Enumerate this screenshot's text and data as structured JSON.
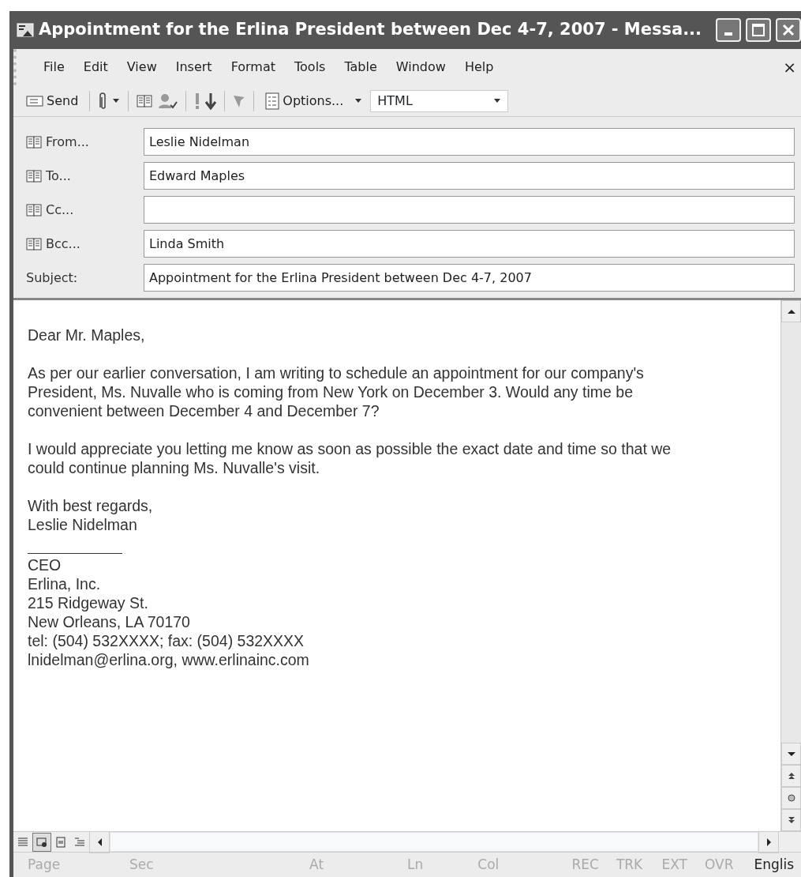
{
  "window": {
    "title": "Appointment for the Erlina President between Dec 4-7, 2007 - Messa..."
  },
  "menu": [
    {
      "label": "File"
    },
    {
      "label": "Edit"
    },
    {
      "label": "View"
    },
    {
      "label": "Insert"
    },
    {
      "label": "Format"
    },
    {
      "label": "Tools"
    },
    {
      "label": "Table"
    },
    {
      "label": "Window"
    },
    {
      "label": "Help"
    }
  ],
  "menu_close": "×",
  "toolbar": {
    "send": "Send",
    "options": "Options...",
    "format": "HTML"
  },
  "header_fields": [
    {
      "label": "From...",
      "value": "Leslie Nidelman",
      "kind": "address"
    },
    {
      "label": "To...",
      "value": "Edward Maples",
      "kind": "address"
    },
    {
      "label": "Cc...",
      "kind": "address"
    },
    {
      "label": "Bcc...",
      "value": "Linda Smith",
      "kind": "address"
    },
    {
      "label": "Subject:",
      "value": "Appointment for the Erlina President between Dec 4-7, 2007",
      "kind": "plain"
    }
  ],
  "body": {
    "paragraphs": [
      "Dear Mr. Maples,",
      "As per our earlier conversation, I am writing to schedule an appointment for our company's President, Ms. Nuvalle who is coming from New York on December 3. Would any time be convenient between December 4 and December 7?",
      "I would appreciate you letting me know as soon as possible the exact date and time so that we could continue planning Ms. Nuvalle's visit.",
      "With best regards,\nLeslie Nidelman"
    ],
    "signature": [
      "CEO",
      "Erlina, Inc.",
      "215 Ridgeway St.",
      "New Orleans, LA 70170",
      "tel: (504) 532XXXX; fax: (504) 532XXXX",
      "lnidelman@erlina.org, www.erlinainc.com"
    ]
  },
  "view_buttons": [
    {
      "kind": "normal",
      "selected": false
    },
    {
      "kind": "web",
      "selected": true
    },
    {
      "kind": "print",
      "selected": false
    },
    {
      "kind": "outline",
      "selected": false
    }
  ],
  "status_bar": [
    {
      "label": "Page",
      "disabled": true
    },
    {
      "label": "Sec",
      "disabled": true
    },
    {
      "label": "At",
      "disabled": true
    },
    {
      "label": "Ln",
      "disabled": true
    },
    {
      "label": "Col",
      "disabled": true
    },
    {
      "label": "REC",
      "disabled": true
    },
    {
      "label": "TRK",
      "disabled": true
    },
    {
      "label": "EXT",
      "disabled": true
    },
    {
      "label": "OVR",
      "disabled": true
    },
    {
      "label": "Englis",
      "disabled": false
    }
  ]
}
